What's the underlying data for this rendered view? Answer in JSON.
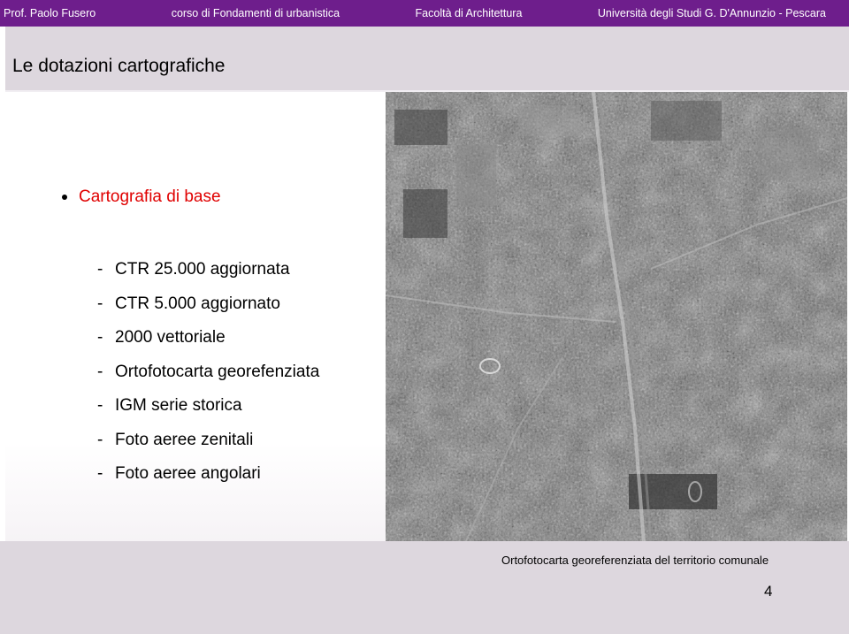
{
  "header": {
    "author": "Prof. Paolo Fusero",
    "course": "corso di Fondamenti di urbanistica",
    "faculty": "Facoltà di Architettura",
    "university": "Università degli Studi G. D'Annunzio - Pescara"
  },
  "slide": {
    "title": "Le dotazioni cartografiche",
    "main_bullet": "Cartografia di base",
    "items": [
      "CTR 25.000 aggiornata",
      "CTR 5.000 aggiornato",
      "2000 vettoriale",
      "Ortofotocarta georefenziata",
      "IGM serie storica",
      "Foto aeree zenitali",
      "Foto aeree angolari"
    ],
    "dash": "-"
  },
  "footer": {
    "caption": "Ortofotocarta georeferenziata del territorio comunale",
    "page_number": "4"
  },
  "colors": {
    "header_bar": "#6e1e8c",
    "title_band": "#ddd7de",
    "main_bullet_text": "#e00000"
  }
}
